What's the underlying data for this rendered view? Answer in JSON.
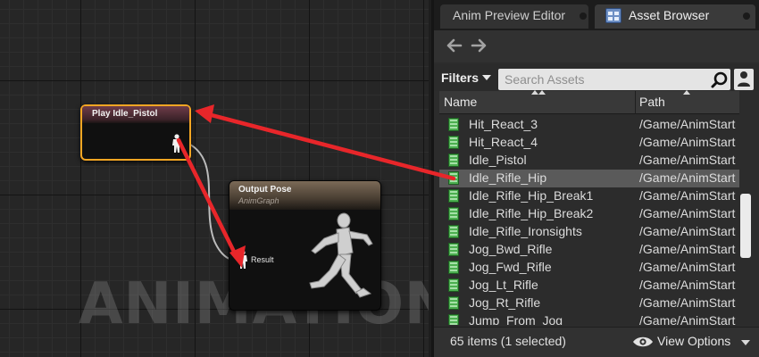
{
  "graph": {
    "watermark": "ANIMATION",
    "play_node": {
      "title": "Play Idle_Pistol"
    },
    "output_node": {
      "title": "Output Pose",
      "subtitle": "AnimGraph",
      "pin_label": "Result"
    }
  },
  "tabs": [
    {
      "label": "Anim Preview Editor"
    },
    {
      "label": "Asset Browser"
    }
  ],
  "filters": {
    "label": "Filters"
  },
  "search": {
    "placeholder": "Search Assets",
    "value": ""
  },
  "columns": {
    "name": "Name",
    "path": "Path"
  },
  "assets": [
    {
      "name": "Hit_React_3",
      "path": "/Game/AnimStarterPack"
    },
    {
      "name": "Hit_React_4",
      "path": "/Game/AnimStarterPack"
    },
    {
      "name": "Idle_Pistol",
      "path": "/Game/AnimStarterPack"
    },
    {
      "name": "Idle_Rifle_Hip",
      "path": "/Game/AnimStarterPack",
      "selected": true
    },
    {
      "name": "Idle_Rifle_Hip_Break1",
      "path": "/Game/AnimStarterPack"
    },
    {
      "name": "Idle_Rifle_Hip_Break2",
      "path": "/Game/AnimStarterPack"
    },
    {
      "name": "Idle_Rifle_Ironsights",
      "path": "/Game/AnimStarterPack"
    },
    {
      "name": "Jog_Bwd_Rifle",
      "path": "/Game/AnimStarterPack"
    },
    {
      "name": "Jog_Fwd_Rifle",
      "path": "/Game/AnimStarterPack"
    },
    {
      "name": "Jog_Lt_Rifle",
      "path": "/Game/AnimStarterPack"
    },
    {
      "name": "Jog_Rt_Rifle",
      "path": "/Game/AnimStarterPack"
    },
    {
      "name": "Jump_From_Jog",
      "path": "/Game/AnimStarterPack"
    }
  ],
  "footer": {
    "item_count": "65 items (1 selected)",
    "view_options": "View Options"
  },
  "colors": {
    "accent_arrow": "#e8262a",
    "selected_node_border": "#f5a623",
    "asset_icon": "#4caf50"
  }
}
